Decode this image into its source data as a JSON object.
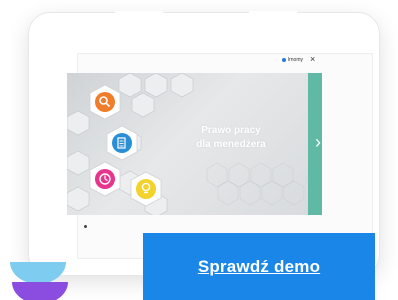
{
  "brand": {
    "label": "lrnomy"
  },
  "close": {
    "label": "×"
  },
  "slide": {
    "title_line1": "Prawo pracy",
    "title_line2": "dla menedżera",
    "next_glyph": "›"
  },
  "cta": {
    "label": "Sprawdź demo"
  },
  "icons": [
    "search-icon",
    "document-icon",
    "clock-icon",
    "lightbulb-icon"
  ],
  "colors": {
    "cta": "#1a86e8",
    "slide_bar": "#5fb9a5",
    "icon_orange": "#f07d2a",
    "icon_blue": "#2b8fd6",
    "icon_pink": "#e6358c",
    "icon_yellow": "#f2d22b"
  }
}
